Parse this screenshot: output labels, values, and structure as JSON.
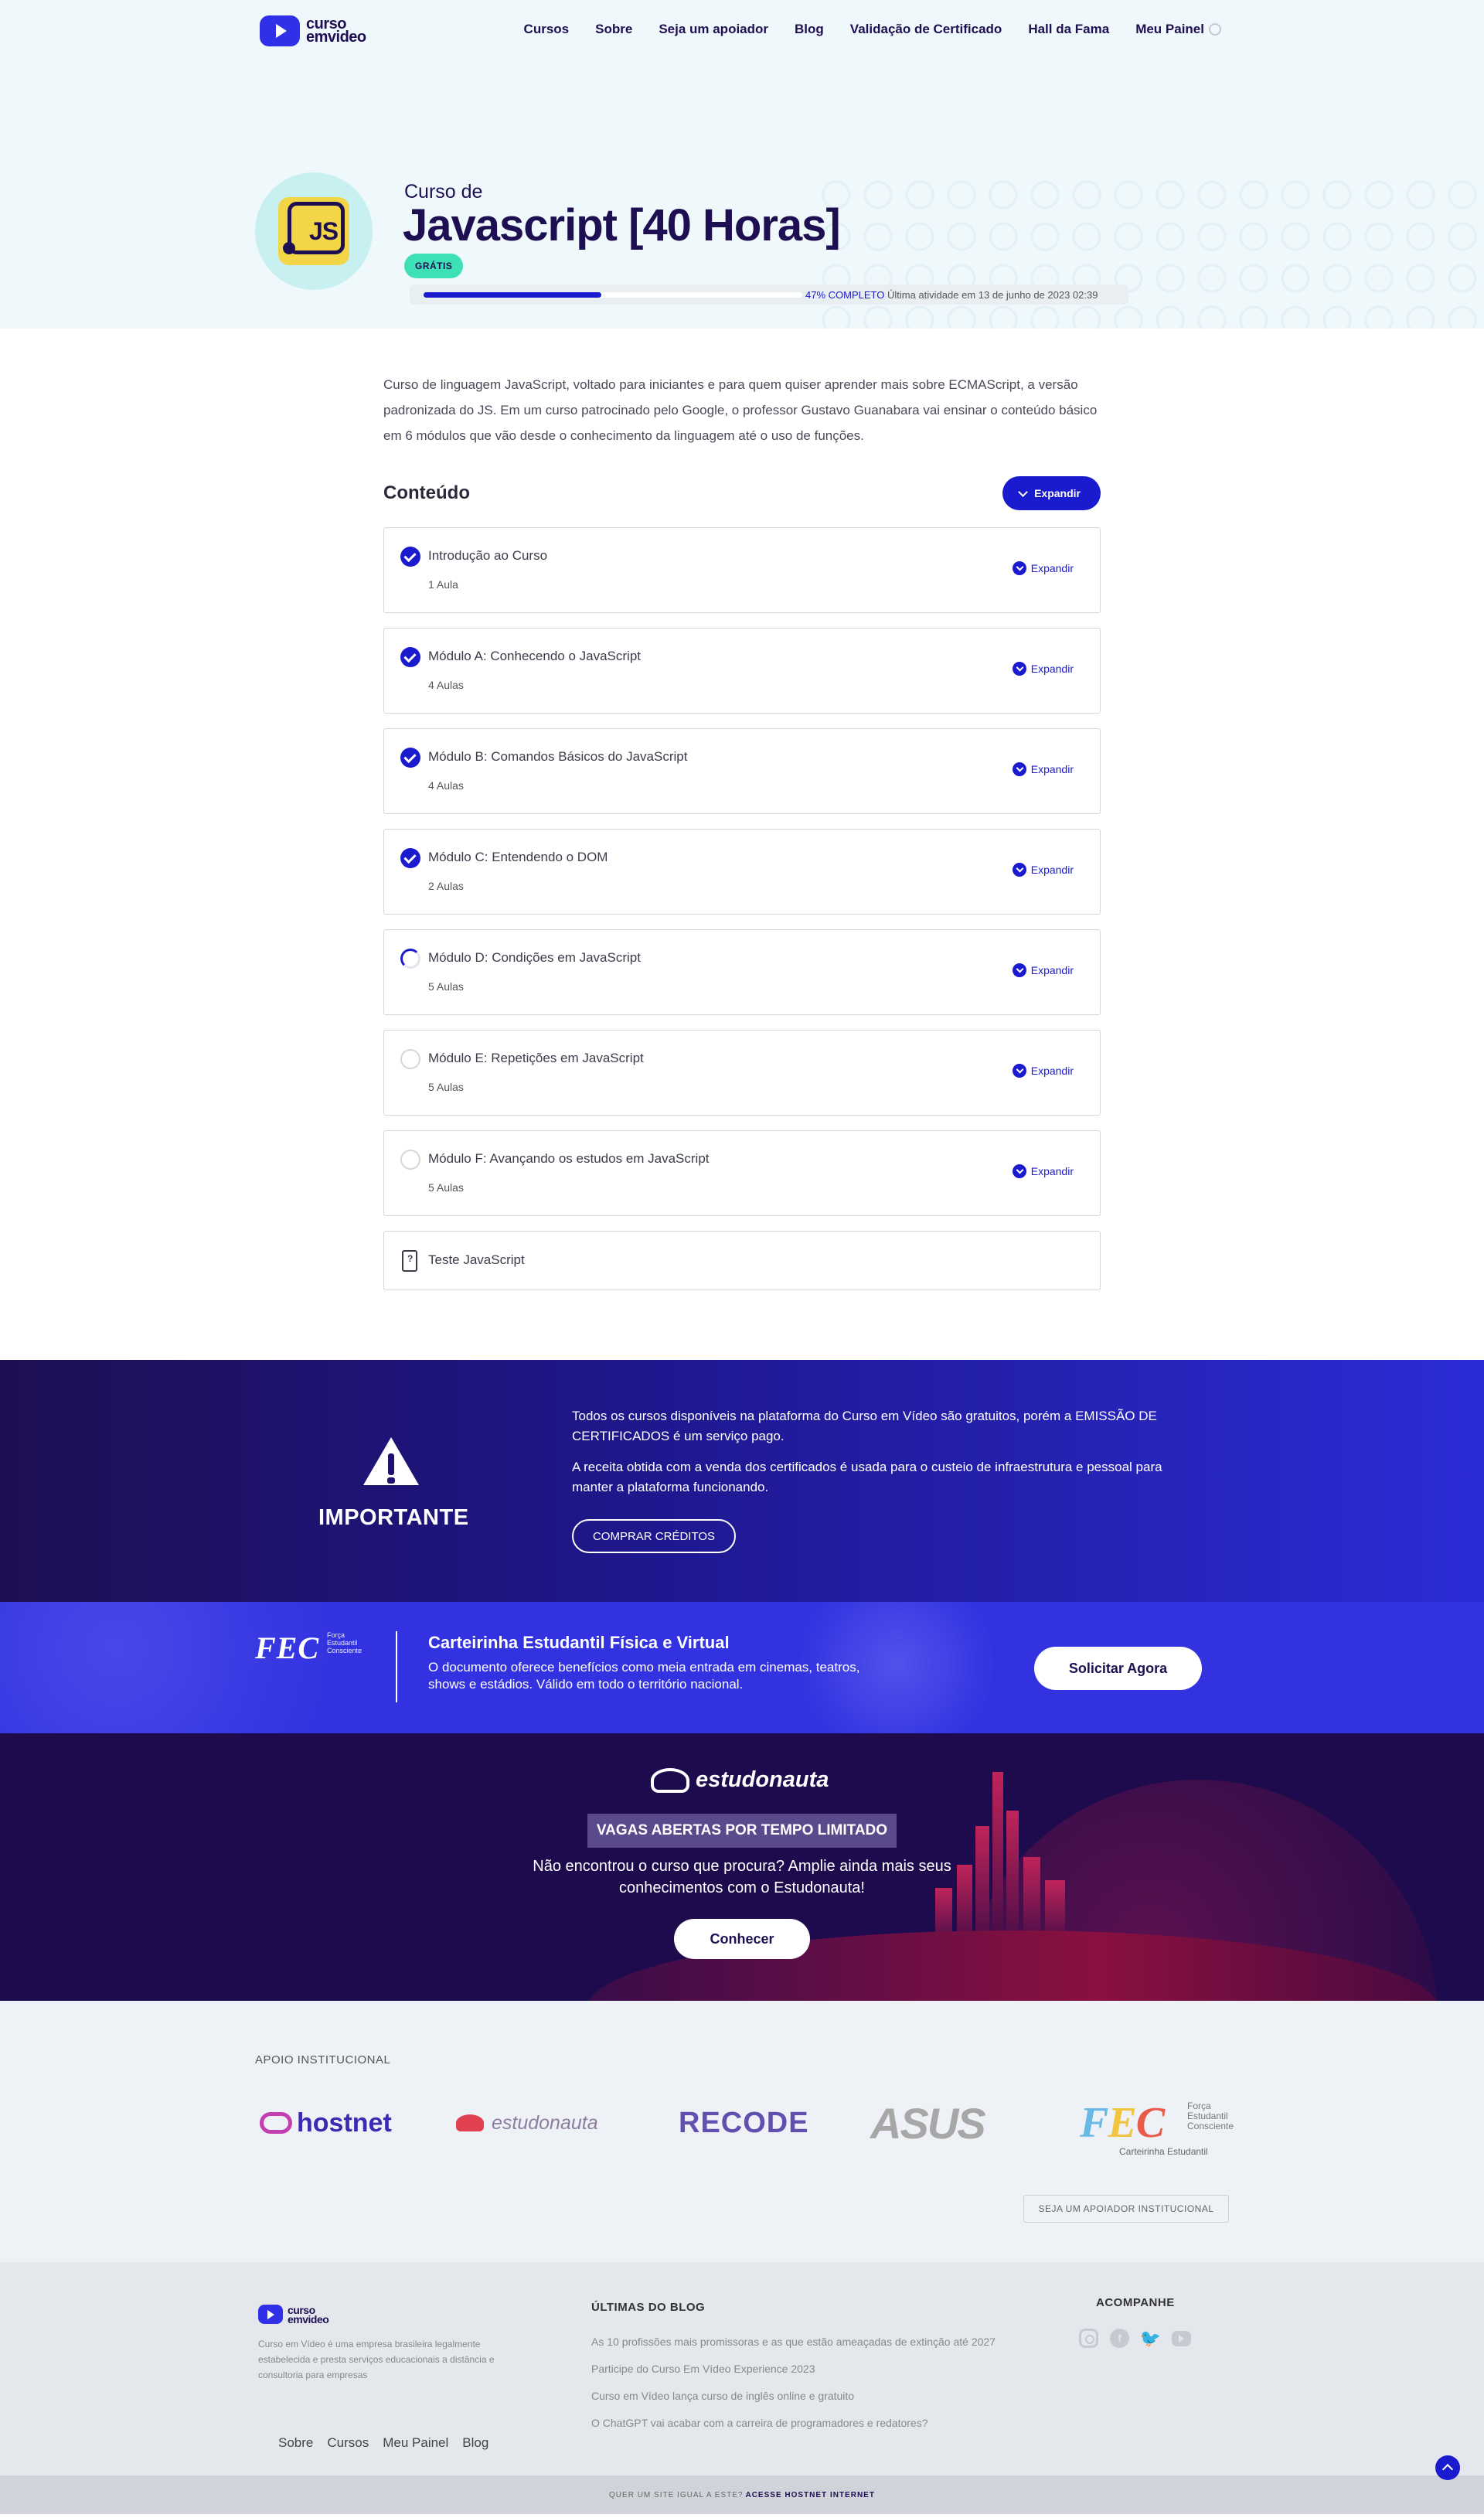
{
  "brand": {
    "logo_line1": "curso",
    "logo_line2": "emvideo"
  },
  "nav": [
    "Cursos",
    "Sobre",
    "Seja um apoiador",
    "Blog",
    "Validação de Certificado",
    "Hall da Fama",
    "Meu Painel"
  ],
  "hero": {
    "pre_title": "Curso de",
    "title": "Javascript [40 Horas]",
    "badge": "GRÁTIS",
    "icon_label": "JS",
    "progress": 0.47,
    "progress_label": "47% COMPLETO",
    "last_activity": "Última atividade em 13 de junho de 2023 02:39"
  },
  "description": "Curso de linguagem JavaScript, voltado para iniciantes e para quem quiser aprender mais sobre ECMAScript, a versão padronizada do JS. Em um curso patrocinado pelo Google, o professor Gustavo Guanabara vai ensinar o conteúdo básico em 6 módulos que vão desde o conhecimento da linguagem até o uso de funções.",
  "content": {
    "title": "Conteúdo",
    "expand_all": "Expandir",
    "modules": [
      {
        "title": "Introdução ao Curso",
        "count": "1 Aula",
        "status": "done",
        "expand": "Expandir"
      },
      {
        "title": "Módulo A: Conhecendo o JavaScript",
        "count": "4 Aulas",
        "status": "done",
        "expand": "Expandir"
      },
      {
        "title": "Módulo B: Comandos Básicos do JavaScript",
        "count": "4 Aulas",
        "status": "done",
        "expand": "Expandir"
      },
      {
        "title": "Módulo C: Entendendo o DOM",
        "count": "2 Aulas",
        "status": "done",
        "expand": "Expandir"
      },
      {
        "title": "Módulo D: Condições em JavaScript",
        "count": "5 Aulas",
        "status": "partial",
        "expand": "Expandir"
      },
      {
        "title": "Módulo E: Repetições em JavaScript",
        "count": "5 Aulas",
        "status": "todo",
        "expand": "Expandir"
      },
      {
        "title": "Módulo F: Avançando os estudos em JavaScript",
        "count": "5 Aulas",
        "status": "todo",
        "expand": "Expandir"
      }
    ],
    "test": "Teste JavaScript"
  },
  "important": {
    "title": "IMPORTANTE",
    "p1": "Todos os cursos disponíveis na plataforma do Curso em Vídeo são gratuitos, porém a EMISSÃO DE CERTIFICADOS é um serviço pago.",
    "p2": "A receita obtida com a venda dos certificados é usada para o custeio de infraestrutura e pessoal para manter a plataforma funcionando.",
    "button": "COMPRAR CRÉDITOS"
  },
  "fec": {
    "logo": "FEC",
    "logo_sub": [
      "Força",
      "Estudantil",
      "Consciente"
    ],
    "title": "Carteirinha Estudantil Física e Virtual",
    "desc": "O documento oferece benefícios como meia entrada em cinemas, teatros, shows e estádios. Válido em todo o território nacional.",
    "button": "Solicitar Agora"
  },
  "estudonauta": {
    "logo": "estudonauta",
    "badge": "VAGAS ABERTAS POR TEMPO LIMITADO",
    "desc": "Não encontrou o curso que procura? Amplie ainda mais seus conhecimentos com o Estudonauta!",
    "button": "Conhecer"
  },
  "sponsors": {
    "label": "APOIO INSTITUCIONAL",
    "logos": [
      "hostnet",
      "estudonauta",
      "RECODE",
      "ASUS",
      "FEC"
    ],
    "fec_sub": [
      "Força",
      "Estudantil",
      "Consciente"
    ],
    "fec_tag": "Carteirinha Estudantil",
    "button": "SEJA UM APOIADOR INSTITUCIONAL"
  },
  "footer": {
    "about": "Curso em Vídeo é uma empresa brasileira legalmente estabelecida e presta serviços educacionais a distância e consultoria para empresas",
    "links": [
      "Sobre",
      "Cursos",
      "Meu Painel",
      "Blog"
    ],
    "blog_title": "ÚLTIMAS DO BLOG",
    "blog_posts": [
      "As 10 profissões mais promissoras e as que estão ameaçadas de extinção até 2027",
      "Participe do Curso Em Vídeo Experience 2023",
      "Curso em Vídeo lança curso de inglês online e gratuito",
      "O ChatGPT vai acabar com a carreira de programadores e redatores?"
    ],
    "follow_title": "ACOMPANHE",
    "social_icons": [
      "instagram-icon",
      "facebook-icon",
      "twitter-icon",
      "youtube-icon"
    ],
    "bottom_text": "QUER UM SITE IGUAL A ESTE?",
    "bottom_link": "ACESSE HOSTNET INTERNET"
  },
  "colors": {
    "primary": "#1a1acf",
    "dark": "#1e0f52",
    "accent": "#3ee0b5"
  }
}
